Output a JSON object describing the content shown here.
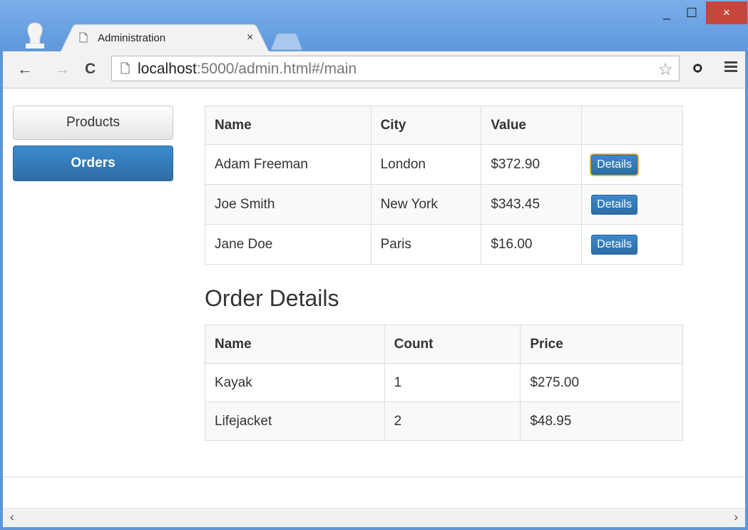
{
  "browser": {
    "tab_title": "Administration",
    "tab_close": "×",
    "url_host": "localhost",
    "url_rest": ":5000/admin.html#/main",
    "window_controls": {
      "minimize": "_",
      "maximize": "☐",
      "close": "×"
    }
  },
  "sidebar": {
    "items": [
      {
        "label": "Products",
        "active": false
      },
      {
        "label": "Orders",
        "active": true
      }
    ]
  },
  "orders_table": {
    "headers": [
      "Name",
      "City",
      "Value",
      ""
    ],
    "rows": [
      {
        "name": "Adam Freeman",
        "city": "London",
        "value": "$372.90",
        "action": "Details"
      },
      {
        "name": "Joe Smith",
        "city": "New York",
        "value": "$343.45",
        "action": "Details"
      },
      {
        "name": "Jane Doe",
        "city": "Paris",
        "value": "$16.00",
        "action": "Details"
      }
    ]
  },
  "order_details": {
    "title": "Order Details",
    "headers": [
      "Name",
      "Count",
      "Price"
    ],
    "rows": [
      {
        "name": "Kayak",
        "count": "1",
        "price": "$275.00"
      },
      {
        "name": "Lifejacket",
        "count": "2",
        "price": "$48.95"
      }
    ]
  },
  "colors": {
    "primary": "#337ab7",
    "frame": "#5e95d8",
    "close": "#c7463b"
  },
  "icons": {
    "back": "arrow-left-icon",
    "forward": "arrow-right-icon",
    "reload": "reload-icon",
    "page": "document-icon",
    "bookmark": "star-icon",
    "extension": "extension-icon",
    "menu": "hamburger-menu-icon"
  }
}
